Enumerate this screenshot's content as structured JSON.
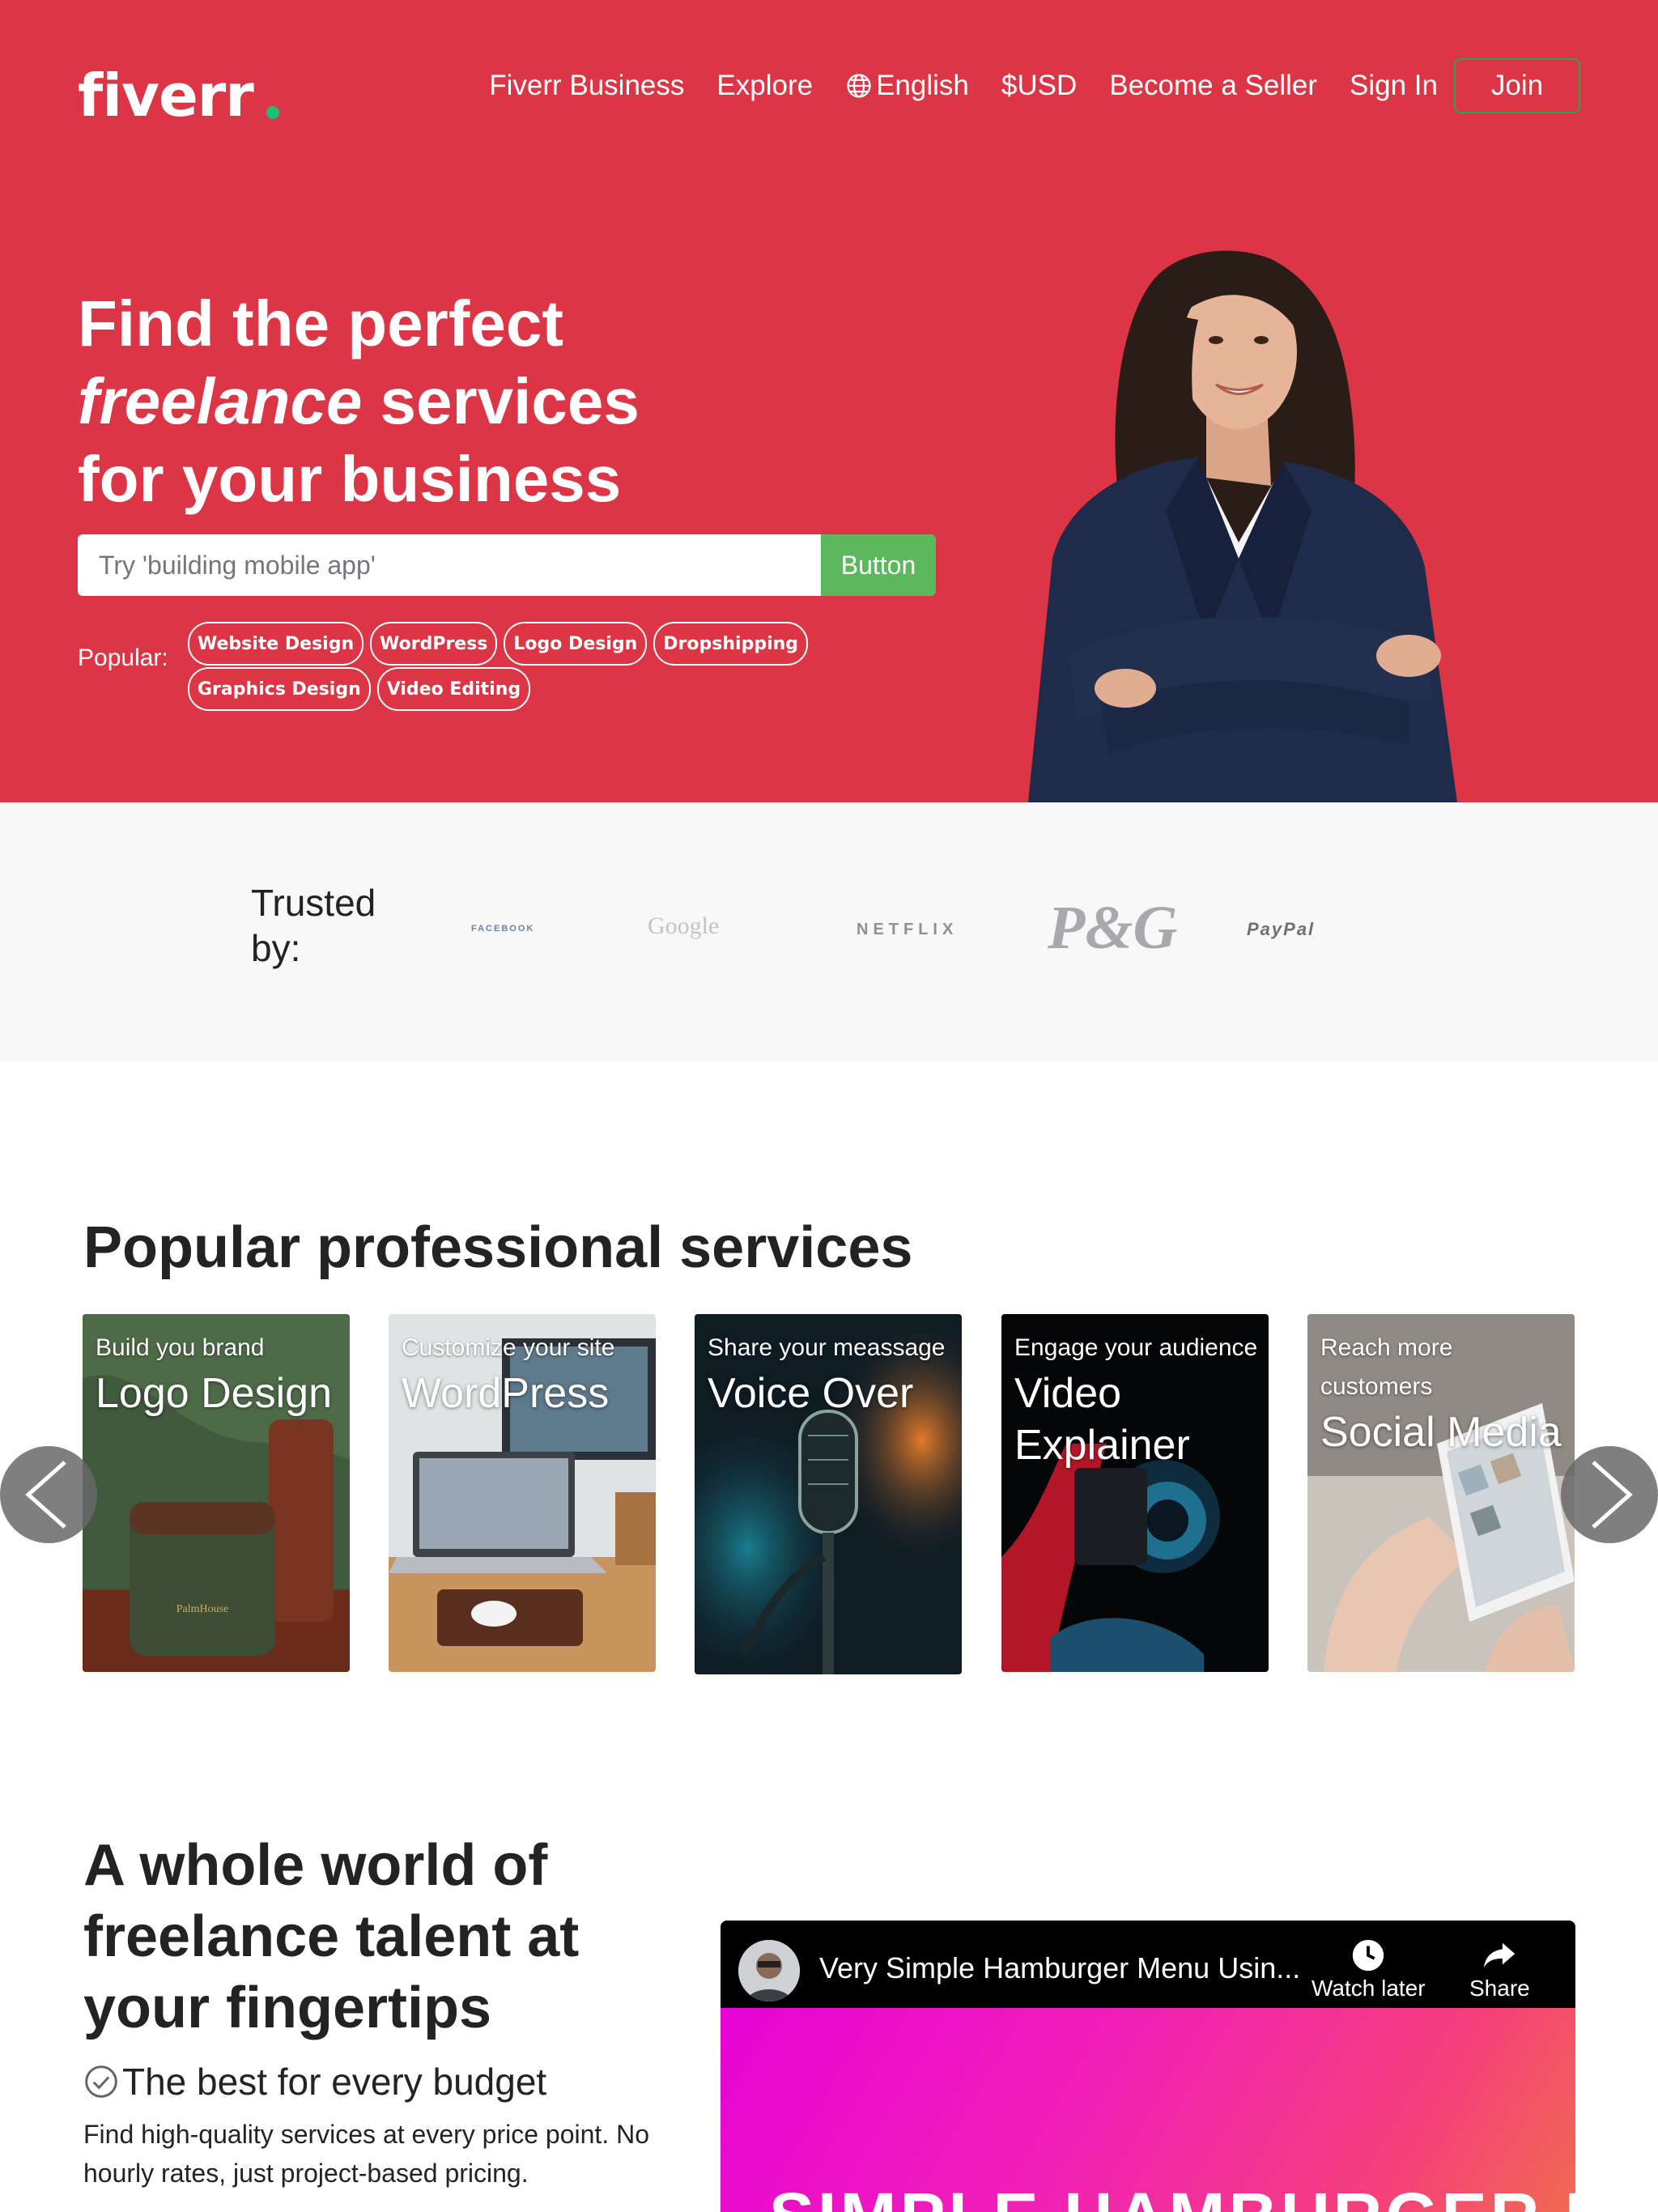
{
  "header": {
    "logo": "fiverr",
    "nav": [
      "Fiverr Business",
      "Explore",
      "English",
      "$USD",
      "Become a Seller",
      "Sign In"
    ],
    "join_label": "Join"
  },
  "hero": {
    "headline_line1": "Find the perfect",
    "headline_em": "freelance",
    "headline_line2_rest": " services",
    "headline_line3": "for your business",
    "search_placeholder": "Try 'building mobile app'",
    "search_button": "Button",
    "popular_label": "Popular:",
    "chips": [
      "Website Design",
      "WordPress",
      "Logo Design",
      "Dropshipping",
      "Graphics Design",
      "Video Editing"
    ]
  },
  "trusted": {
    "label": "Trusted by:",
    "brands": [
      "FACEBOOK",
      "Google",
      "NETFLIX",
      "P&G",
      "PayPal"
    ]
  },
  "services": {
    "title": "Popular professional services",
    "cards": [
      {
        "subtitle": "Build you brand",
        "title": "Logo Design"
      },
      {
        "subtitle": "Customize your site",
        "title": "WordPress"
      },
      {
        "subtitle": "Share your meassage",
        "title": "Voice Over"
      },
      {
        "subtitle": "Engage your audience",
        "title": "Video Explainer"
      },
      {
        "subtitle": "Reach more customers",
        "title": "Social Media"
      }
    ]
  },
  "talent": {
    "title": "A whole world of freelance talent at your fingertips",
    "feature_title": "The best for every budget",
    "feature_text": "Find high-quality services at every price point. No hourly rates, just project-based pricing."
  },
  "video": {
    "title": "Very Simple Hamburger Menu Usin...",
    "watch_later": "Watch later",
    "share": "Share",
    "overlay_text": "SIMPLE HAMBURGER MENU"
  },
  "colors": {
    "hero_bg": "#dc3545",
    "accent_green": "#1dbf73",
    "button_green": "#5cb85c",
    "trusted_bg": "#f8f8f8"
  }
}
